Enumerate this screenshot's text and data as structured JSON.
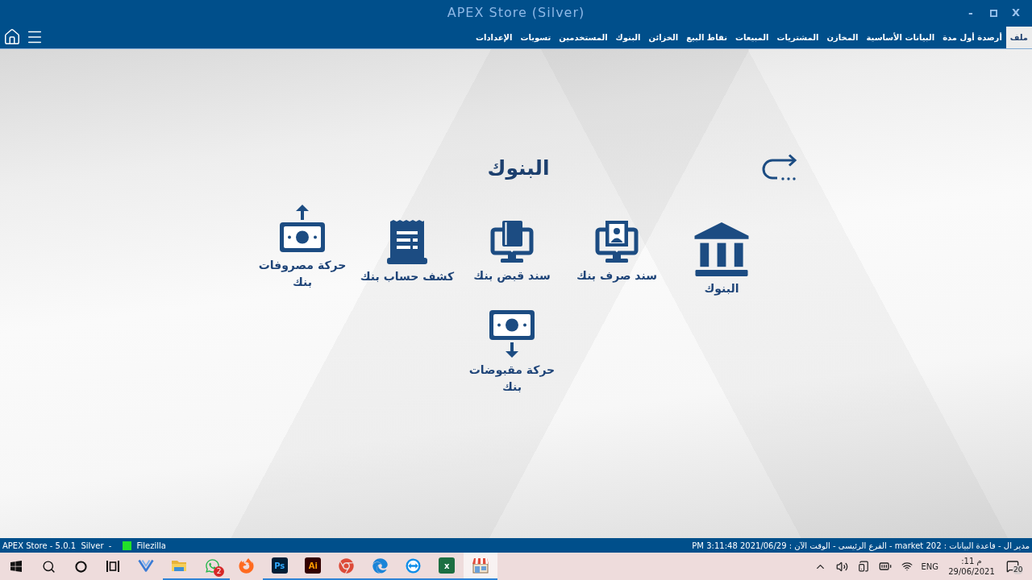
{
  "window": {
    "title": "APEX Store (Silver)",
    "minimize": "-",
    "close": "X"
  },
  "menu": {
    "tabs": [
      {
        "label": "ملف",
        "selected": true
      },
      {
        "label": "أرصدة أول مدة",
        "selected": false
      },
      {
        "label": "البيانات الأساسية",
        "selected": false
      },
      {
        "label": "المخازن",
        "selected": false
      },
      {
        "label": "المشتريات",
        "selected": false
      },
      {
        "label": "المبيعات",
        "selected": false
      },
      {
        "label": "نقاط البيع",
        "selected": false
      },
      {
        "label": "الخزائن",
        "selected": false
      },
      {
        "label": "البنوك",
        "selected": false
      },
      {
        "label": "المستخدمين",
        "selected": false
      },
      {
        "label": "تسويات",
        "selected": false
      },
      {
        "label": "الإعدادات",
        "selected": false
      }
    ]
  },
  "page": {
    "title": "البنوك",
    "items": [
      {
        "kind": "bank",
        "label": "البنوك"
      },
      {
        "kind": "payment_voucher",
        "label": "سند صرف بنك"
      },
      {
        "kind": "receipt_voucher",
        "label": "سند قبض بنك"
      },
      {
        "kind": "statement",
        "label": "كشف حساب بنك"
      },
      {
        "kind": "money_out",
        "label": "حركة مصروفات بنك"
      },
      {
        "kind": "money_in",
        "label": "حركة مقبوضات بنك"
      }
    ]
  },
  "status_bar": {
    "version": "APEX Store - 5.0.1  Silver  -",
    "connection": "Filezilla",
    "info": "مدير ال - قاعدة البيانات : 202 market - الفرع الرئيسى - الوقت الآن : 2021/06/29 3:11:48 PM"
  },
  "taskbar": {
    "tray": {
      "notifications": "20",
      "time": ":11 م",
      "date": "29/06/2021",
      "language": "ENG",
      "icons": [
        {
          "kind": "wifi"
        },
        {
          "kind": "battery"
        },
        {
          "kind": "device"
        },
        {
          "kind": "speaker"
        },
        {
          "kind": "chevron"
        }
      ]
    },
    "apps": [
      {
        "kind": "store",
        "running": true,
        "selected": true
      },
      {
        "kind": "tile",
        "label": "x",
        "running": true,
        "selected": false
      },
      {
        "kind": "arrows",
        "running": true,
        "selected": false
      },
      {
        "kind": "wave",
        "running": true,
        "selected": false
      },
      {
        "kind": "tricolor",
        "running": true,
        "selected": false
      },
      {
        "kind": "tile",
        "label": "Ai",
        "running": true,
        "selected": false
      },
      {
        "kind": "tile",
        "label": "Ps",
        "running": true,
        "selected": false
      },
      {
        "kind": "fox",
        "running": false,
        "selected": false
      },
      {
        "kind": "chat",
        "running": true,
        "selected": false,
        "badge": "2"
      },
      {
        "kind": "folder",
        "running": true,
        "selected": false
      },
      {
        "kind": "v_logo",
        "running": false,
        "selected": false
      }
    ],
    "system_buttons": [
      {
        "kind": "task_view"
      },
      {
        "kind": "cortana"
      },
      {
        "kind": "search"
      },
      {
        "kind": "start"
      }
    ]
  }
}
